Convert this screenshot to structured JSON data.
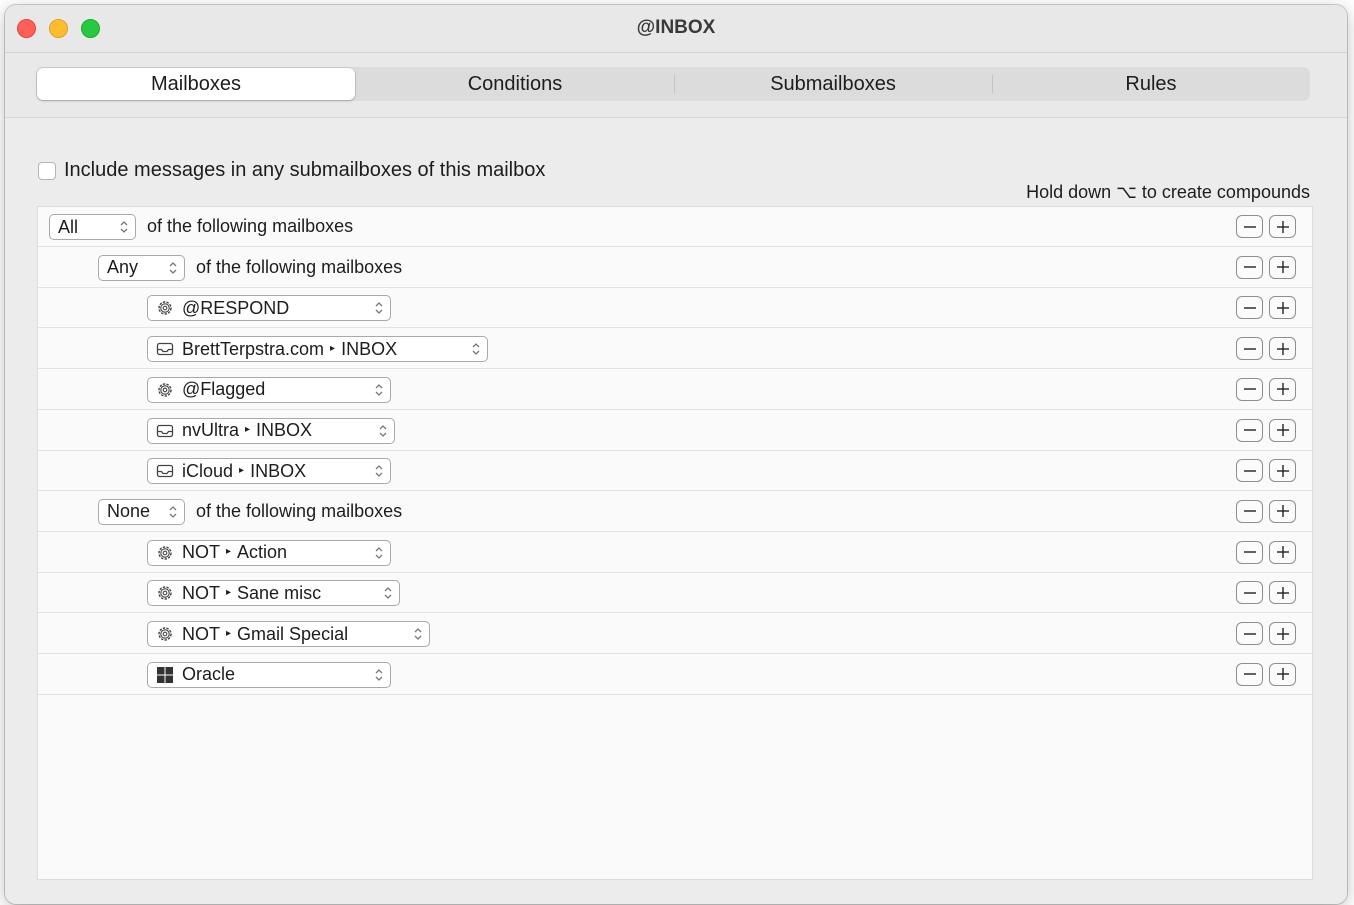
{
  "window": {
    "title": "@INBOX"
  },
  "tabs": [
    {
      "label": "Mailboxes",
      "active": true
    },
    {
      "label": "Conditions",
      "active": false
    },
    {
      "label": "Submailboxes",
      "active": false
    },
    {
      "label": "Rules",
      "active": false
    }
  ],
  "include_submailboxes": {
    "label": "Include messages in any submailboxes of this mailbox",
    "checked": false
  },
  "hint": "Hold down ⌥ to create compounds",
  "rows": [
    {
      "kind": "group",
      "level": 0,
      "selector": "All",
      "text": "of the following mailboxes"
    },
    {
      "kind": "group",
      "level": 1,
      "selector": "Any",
      "text": "of the following mailboxes"
    },
    {
      "kind": "mailbox",
      "level": 2,
      "icon": "gear-icon",
      "parts": [
        "@RESPOND"
      ]
    },
    {
      "kind": "mailbox",
      "level": 2,
      "icon": "inbox-icon",
      "parts": [
        "BrettTerpstra.com",
        "INBOX"
      ]
    },
    {
      "kind": "mailbox",
      "level": 2,
      "icon": "gear-icon",
      "parts": [
        "@Flagged"
      ]
    },
    {
      "kind": "mailbox",
      "level": 2,
      "icon": "inbox-icon",
      "parts": [
        "nvUltra",
        "INBOX"
      ]
    },
    {
      "kind": "mailbox",
      "level": 2,
      "icon": "inbox-icon",
      "parts": [
        "iCloud",
        "INBOX"
      ]
    },
    {
      "kind": "group",
      "level": 1,
      "selector": "None",
      "text": "of the following mailboxes"
    },
    {
      "kind": "mailbox",
      "level": 2,
      "icon": "gear-icon",
      "parts": [
        "NOT",
        "Action"
      ]
    },
    {
      "kind": "mailbox",
      "level": 2,
      "icon": "gear-icon",
      "parts": [
        "NOT",
        "Sane misc"
      ]
    },
    {
      "kind": "mailbox",
      "level": 2,
      "icon": "gear-icon",
      "parts": [
        "NOT",
        "Gmail Special"
      ]
    },
    {
      "kind": "mailbox",
      "level": 2,
      "icon": "windows-icon",
      "parts": [
        "Oracle"
      ]
    }
  ],
  "buttons": {
    "minus": "−",
    "plus": "+"
  },
  "path_separator": "▸"
}
